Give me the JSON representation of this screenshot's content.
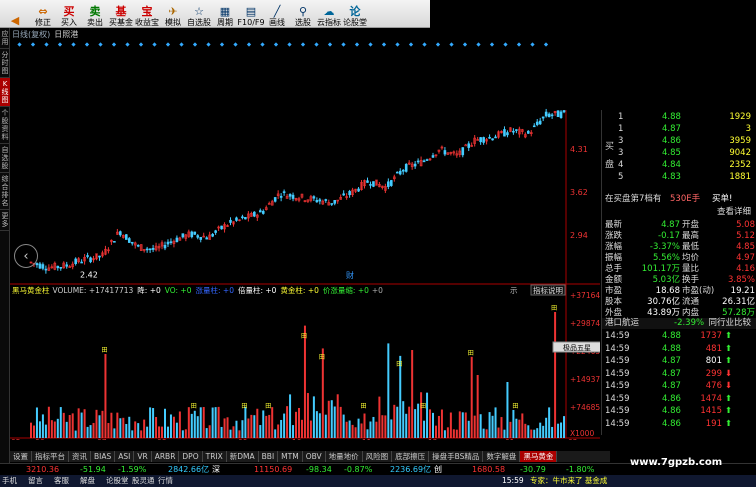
{
  "toolbar": [
    {
      "name": "back-button",
      "label": "",
      "icon": "◀",
      "color": "#c60"
    },
    {
      "name": "correction-button",
      "label": "修正",
      "icon": "⇔",
      "color": "#c60"
    },
    {
      "name": "buy-button",
      "label": "买入",
      "icon": "买",
      "color": "#c00"
    },
    {
      "name": "sell-button",
      "label": "卖出",
      "icon": "卖",
      "color": "#070"
    },
    {
      "name": "buy-fund-button",
      "label": "买基金",
      "icon": "基",
      "color": "#c00"
    },
    {
      "name": "profit-treasure-button",
      "label": "收益宝",
      "icon": "宝",
      "color": "#c00"
    },
    {
      "name": "simulate-button",
      "label": "模拟",
      "icon": "✈",
      "color": "#a60"
    },
    {
      "name": "watchlist-button",
      "label": "自选股",
      "icon": "☆",
      "color": "#036"
    },
    {
      "name": "period-button",
      "label": "周期",
      "icon": "▦",
      "color": "#036"
    },
    {
      "name": "f10-button",
      "label": "F10/F9",
      "icon": "▤",
      "color": "#036"
    },
    {
      "name": "draw-line-button",
      "label": "画线",
      "icon": "╱",
      "color": "#036"
    },
    {
      "name": "stock-screener-button",
      "label": "选股",
      "icon": "⚲",
      "color": "#036"
    },
    {
      "name": "cloud-indicator-button",
      "label": "云指标",
      "icon": "☁",
      "color": "#069"
    },
    {
      "name": "forum-button",
      "label": "论股堂",
      "icon": "论",
      "color": "#069"
    }
  ],
  "sidebar": [
    {
      "label": "应用"
    },
    {
      "label": "分时图"
    },
    {
      "label": "K线图",
      "selected": true
    },
    {
      "label": "个股资料"
    },
    {
      "label": "自选股"
    },
    {
      "label": "综合排名"
    },
    {
      "label": "更多"
    }
  ],
  "chart_title": "日线(复权)",
  "chart_name": "日照港",
  "price_labels": [
    "4.31",
    "3.62",
    "2.94"
  ],
  "low_label": "2.42",
  "cai_label": "财",
  "date_labels": [
    "05",
    "06",
    "07",
    "08",
    "09",
    "10",
    "11",
    "12",
    "01",
    "02"
  ],
  "volume_indicator": {
    "name": "黑马黄金柱",
    "volume": "VOLUME: +17417713",
    "items": [
      {
        "text": "降: +0",
        "color": "#fff"
      },
      {
        "text": "VO: +0",
        "color": "#3e3"
      },
      {
        "text": "涨量柱: +0",
        "color": "#36f"
      },
      {
        "text": "倍量柱: +0",
        "color": "#fff"
      },
      {
        "text": "黄金柱: +0",
        "color": "#ff3"
      },
      {
        "text": "价涨量缩: +0",
        "color": "#3e3"
      }
    ],
    "tail": "+0"
  },
  "indicator_help": "指标说明",
  "vol_labels": [
    "371647",
    "298740",
    "224655",
    "149370",
    "74685",
    "X1000"
  ],
  "popup": "极品五星",
  "tian_labels": [
    "田",
    "田",
    "田",
    "田",
    "田",
    "田",
    "田",
    "田",
    "田",
    "田",
    "田",
    "田"
  ],
  "order_book": {
    "buy_label": "买盘",
    "rows": [
      {
        "level": "1",
        "price": "4.88",
        "vol": "1929"
      },
      {
        "level": "1",
        "price": "4.87",
        "vol": "3"
      },
      {
        "level": "3",
        "price": "4.86",
        "vol": "3959"
      },
      {
        "level": "3",
        "price": "4.85",
        "vol": "9042"
      },
      {
        "level": "4",
        "price": "4.84",
        "vol": "2352"
      },
      {
        "level": "5",
        "price": "4.83",
        "vol": "1881"
      }
    ],
    "summary": "在买盘第7档有",
    "summary_vol": "530E手",
    "summary_btn": "买单!",
    "detail": "查看详细"
  },
  "quotes": [
    {
      "l": "最新",
      "v": "4.87",
      "l2": "开盘",
      "v2": "5.08"
    },
    {
      "l": "涨跌",
      "v": "-0.17",
      "l2": "最高",
      "v2": "5.12"
    },
    {
      "l": "涨幅",
      "v": "-3.37%",
      "l2": "最低",
      "v2": "4.85"
    },
    {
      "l": "振幅",
      "v": "5.56%",
      "l2": "均价",
      "v2": "4.97"
    },
    {
      "l": "总手",
      "v": "101.17万",
      "l2": "量比",
      "v2": "4.16"
    },
    {
      "l": "金额",
      "v": "5.03亿",
      "l2": "换手",
      "v2": "3.85%"
    },
    {
      "l": "市盈",
      "v": "18.68",
      "l2": "市盈(动)",
      "v2": "19.21"
    },
    {
      "l": "股本",
      "v": "30.76亿",
      "l2": "流通",
      "v2": "26.31亿"
    },
    {
      "l": "外盘",
      "v": "43.89万",
      "l2": "内盘",
      "v2": "57.28万"
    }
  ],
  "sector": {
    "name": "港口航运",
    "change": "-2.39%",
    "compare": "同行业比较"
  },
  "trades": [
    {
      "time": "14:59",
      "price": "4.88",
      "vol": "1737",
      "dir": "up"
    },
    {
      "time": "14:59",
      "price": "4.88",
      "vol": "481",
      "dir": "up"
    },
    {
      "time": "14:59",
      "price": "4.87",
      "vol": "801",
      "dir": "up"
    },
    {
      "time": "14:59",
      "price": "4.87",
      "vol": "299",
      "dir": "down"
    },
    {
      "time": "14:59",
      "price": "4.87",
      "vol": "476",
      "dir": "down"
    },
    {
      "time": "14:59",
      "price": "4.86",
      "vol": "1474",
      "dir": "up"
    },
    {
      "time": "14:59",
      "price": "4.86",
      "vol": "1415",
      "dir": "up"
    },
    {
      "time": "14:59",
      "price": "4.86",
      "vol": "191",
      "dir": "up"
    }
  ],
  "bottom_tabs": [
    "设置",
    "指标平台",
    "资讯",
    "BIAS",
    "ASI",
    "VR",
    "ARBR",
    "DPO",
    "TRIX",
    "新DMA",
    "BBI",
    "MTM",
    "OBV",
    "地量地价",
    "风险图",
    "底部擦压",
    "操盘手BS精品",
    "数字解盘",
    "黑马黄金"
  ],
  "active_tab": "黑马黄金",
  "statusbar": {
    "idx1": "3210.36",
    "chg1": "-51.94",
    "pct1": "-1.59%",
    "val1": "2842.66亿",
    "label2": "深",
    "idx2": "11150.69",
    "chg2": "-98.34",
    "pct2": "-0.87%",
    "val2": "2236.69亿",
    "label3": "创",
    "idx3": "1680.58",
    "chg3": "-30.79",
    "pct3": "-1.80%"
  },
  "taskbar": {
    "items": [
      "手机",
      "留言",
      "客服",
      "解盘",
      "论股堂",
      "股灵通",
      "行情"
    ],
    "news_time": "15:59",
    "news": "专家：牛市来了 基金成"
  },
  "watermark": "www.7gpzb.com",
  "chart_data": {
    "type": "candlestick",
    "stock": "日照港",
    "price_axis": [
      2.94,
      3.62,
      4.31
    ],
    "price_range": [
      2.3,
      4.9
    ],
    "x_labels": [
      "05",
      "06",
      "07",
      "08",
      "09",
      "10",
      "11",
      "12",
      "01",
      "02"
    ],
    "approx_close_path": [
      2.5,
      2.42,
      2.45,
      2.55,
      2.6,
      3.0,
      2.75,
      2.7,
      2.85,
      2.95,
      2.9,
      3.1,
      3.2,
      3.3,
      3.6,
      3.55,
      3.5,
      3.45,
      3.6,
      3.8,
      3.7,
      4.0,
      4.1,
      4.3,
      4.2,
      4.45,
      4.5,
      4.6,
      4.55,
      4.85,
      4.87
    ],
    "volume_axis": [
      74685,
      149370,
      224655,
      298740,
      371647
    ],
    "volume_unit": "X1000"
  }
}
